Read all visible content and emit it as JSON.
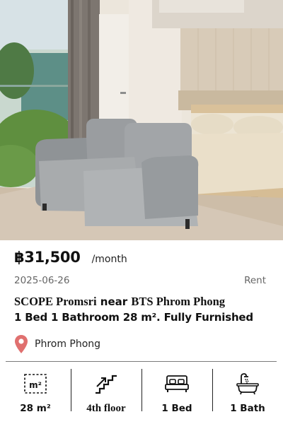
{
  "listing": {
    "price": "฿31,500",
    "price_period": "/month",
    "date": "2025-06-26",
    "type": "Rent",
    "title_project": "SCOPE Promsri",
    "title_near": " near ",
    "title_station": "BTS Phrom Phong",
    "subtitle": "1 Bed 1 Bathroom 28 m². Fully Furnished",
    "location": "Phrom Phong",
    "pin_color": "#e0706f"
  },
  "features": {
    "area": {
      "icon": "area-m2-icon",
      "icon_text": "m²",
      "label": "28 m²"
    },
    "floor": {
      "icon": "stairs-icon",
      "label": "4th floor"
    },
    "bed": {
      "icon": "bed-icon",
      "label": "1 Bed"
    },
    "bath": {
      "icon": "bathtub-icon",
      "label": "1 Bath"
    }
  }
}
